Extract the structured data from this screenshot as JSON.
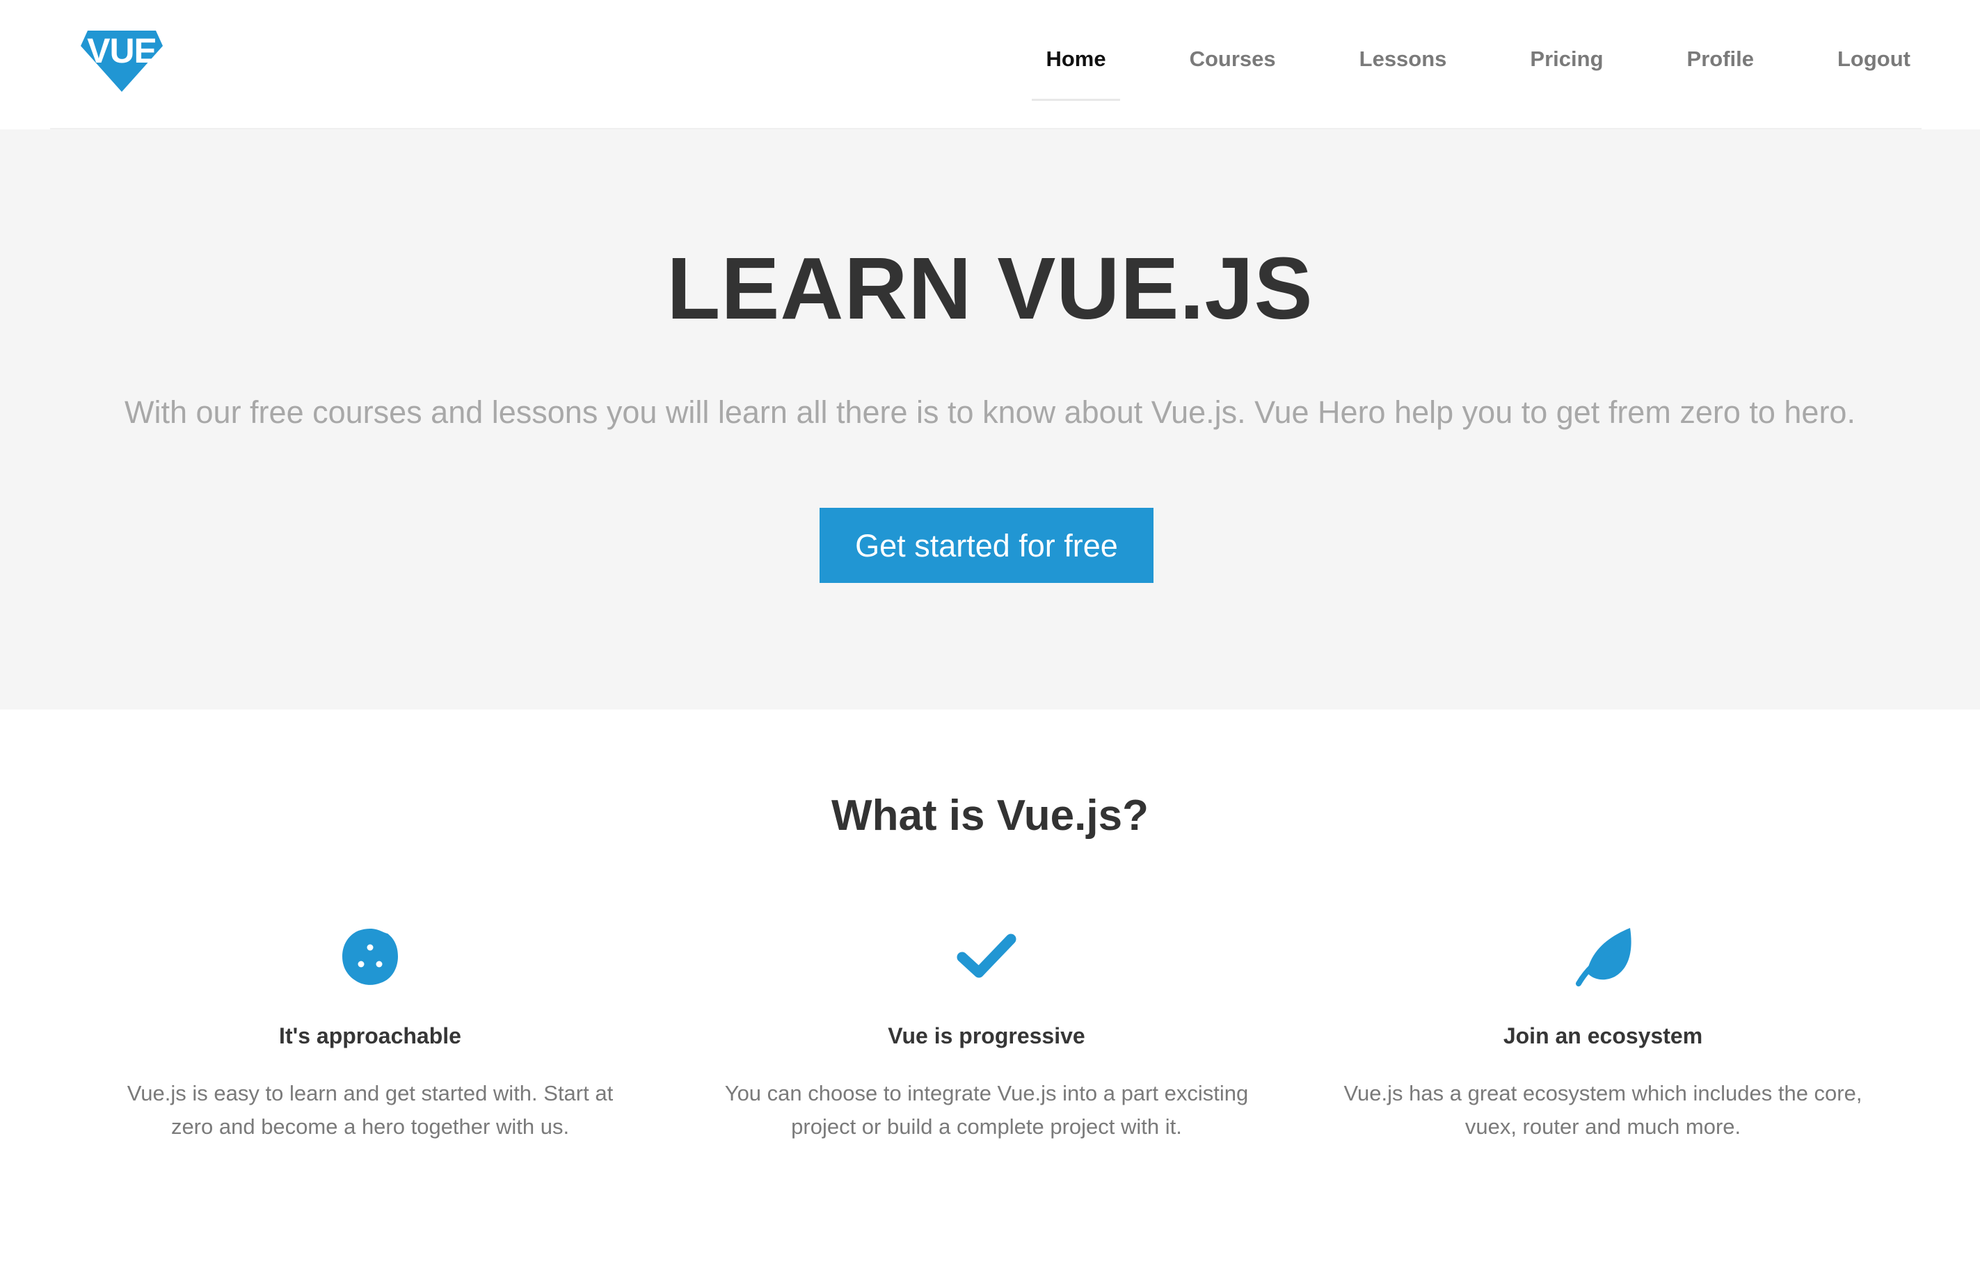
{
  "colors": {
    "accent": "#2196d3",
    "hero_background": "#f5f5f5",
    "heading": "#333333",
    "muted_text": "#7a7a7a",
    "nav_active": "#111111"
  },
  "logo": {
    "text": "VUE",
    "icon": "diamond-shield-icon"
  },
  "nav": {
    "items": [
      {
        "label": "Home",
        "active": true
      },
      {
        "label": "Courses",
        "active": false
      },
      {
        "label": "Lessons",
        "active": false
      },
      {
        "label": "Pricing",
        "active": false
      },
      {
        "label": "Profile",
        "active": false
      },
      {
        "label": "Logout",
        "active": false
      }
    ]
  },
  "hero": {
    "title": "LEARN VUE.JS",
    "subtitle": "With our free courses and lessons you will learn all there is to know about Vue.js. Vue Hero help you to get frem zero to hero.",
    "cta_label": "Get started for free"
  },
  "features": {
    "section_title": "What is Vue.js?",
    "items": [
      {
        "icon": "cookie-icon",
        "title": "It's approachable",
        "text": "Vue.js is easy to learn and get started with. Start at zero and become a hero together with us."
      },
      {
        "icon": "checkmark-icon",
        "title": "Vue is progressive",
        "text": "You can choose to integrate Vue.js into a part excisting project or build a complete project with it."
      },
      {
        "icon": "leaf-icon",
        "title": "Join an ecosystem",
        "text": "Vue.js has a great ecosystem which includes the core, vuex, router and much more."
      }
    ]
  }
}
